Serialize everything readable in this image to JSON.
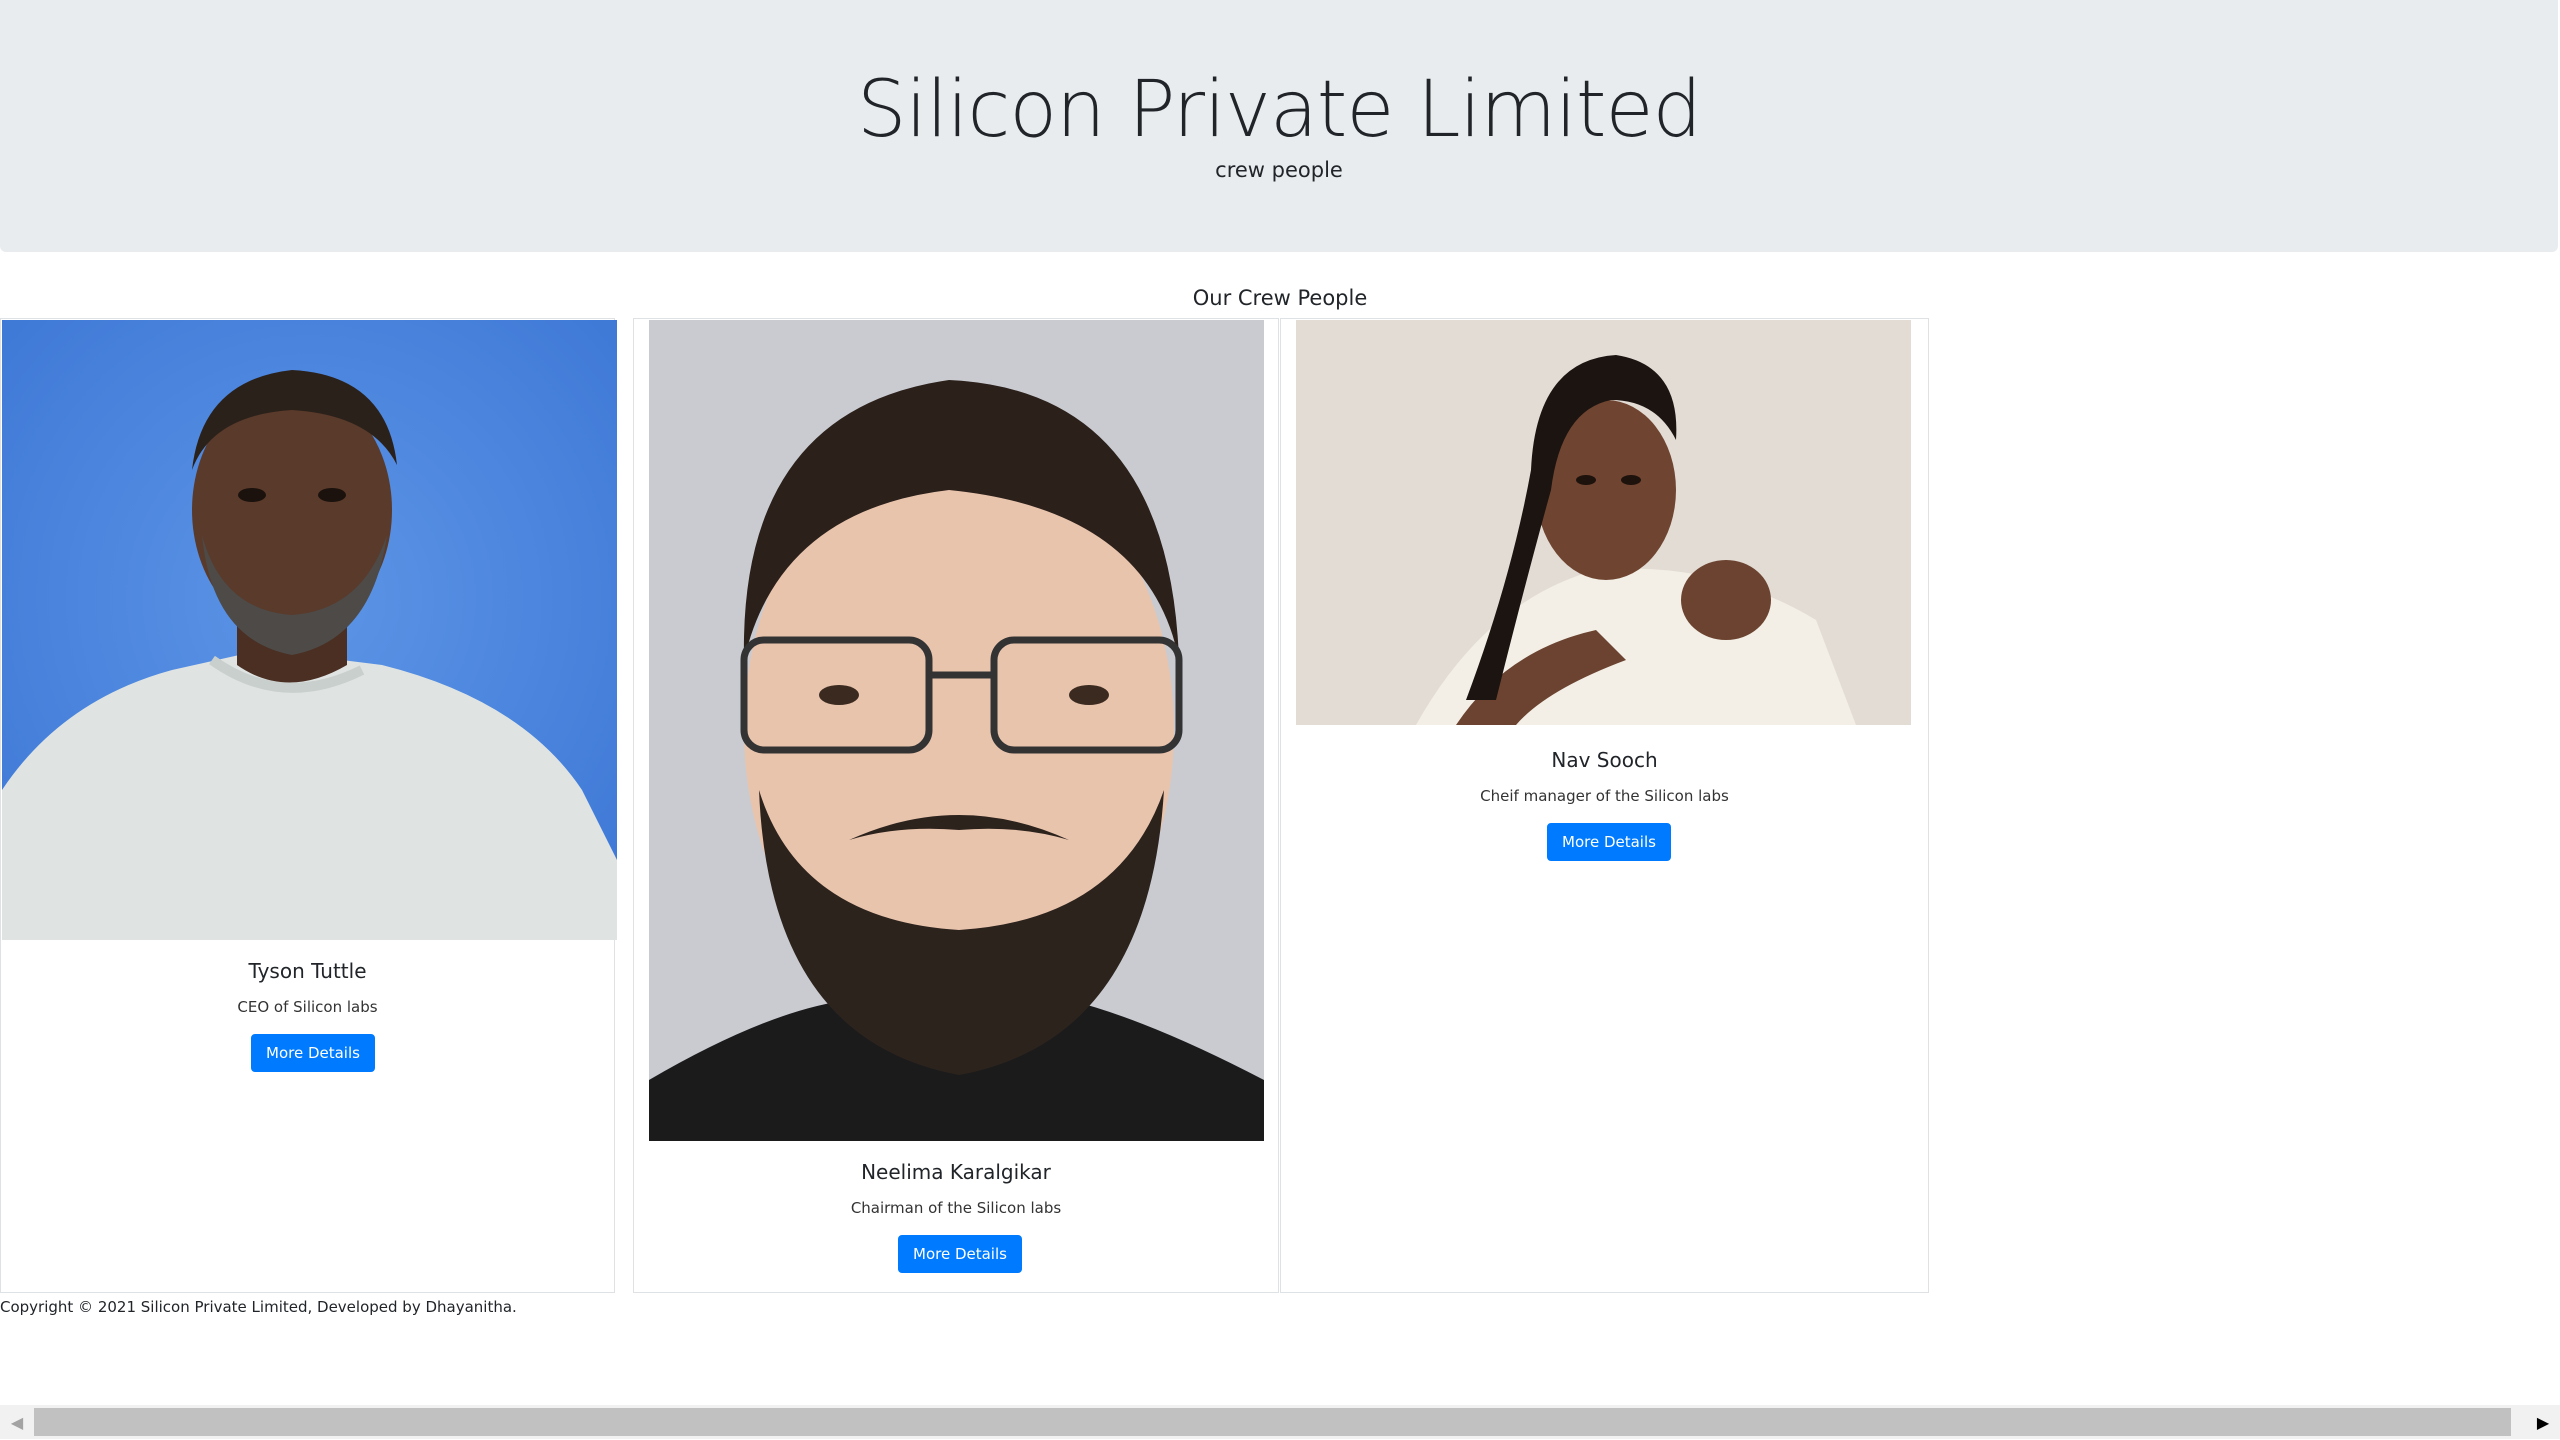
{
  "header": {
    "title": "Silicon Private Limited",
    "subtitle": "crew people"
  },
  "section": {
    "title": "Our Crew People"
  },
  "crew": [
    {
      "name": "Tyson Tuttle",
      "role": "CEO of Silicon labs",
      "button_label": "More Details"
    },
    {
      "name": "Neelima Karalgikar",
      "role": "Chairman of the Silicon labs",
      "button_label": "More Details"
    },
    {
      "name": "Nav Sooch",
      "role": "Cheif manager of the Silicon labs",
      "button_label": "More Details"
    }
  ],
  "footer": {
    "text": "Copyright © 2021 Silicon Private Limited, Developed by Dhayanitha."
  },
  "icons": {
    "scroll_left": "chevron-left-icon",
    "scroll_right": "chevron-right-icon"
  },
  "colors": {
    "jumbotron_bg": "#e9ecef",
    "button_bg": "#007bff"
  }
}
